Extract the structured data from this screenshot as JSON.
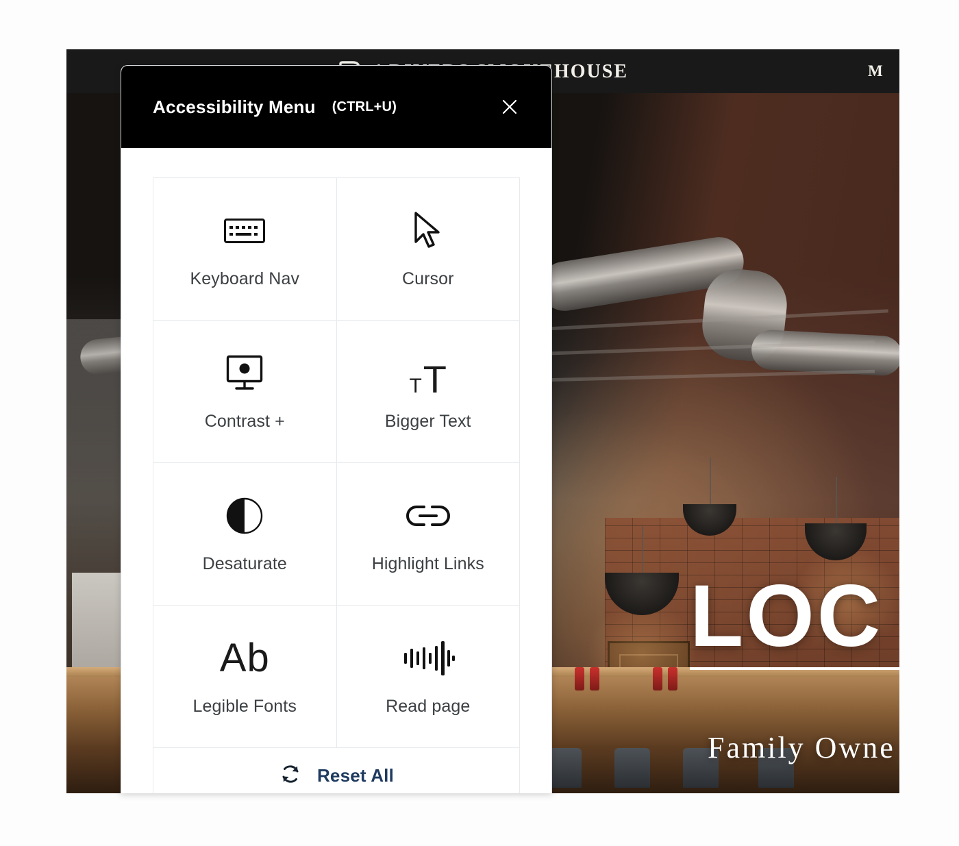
{
  "site": {
    "brand_name": "4 RIVERS SMOKEHOUSE",
    "brand_logo_icon": "r-monogram-logo-icon",
    "nav_right_label": "M",
    "hero_title": "LOC",
    "hero_subtitle": "Family Owne",
    "hero_image_alt": "restaurant-interior-photo"
  },
  "modal": {
    "title": "Accessibility Menu",
    "shortcut": "(CTRL+U)",
    "close_icon": "close-icon",
    "items": [
      {
        "label": "Keyboard Nav",
        "icon": "keyboard-icon"
      },
      {
        "label": "Cursor",
        "icon": "cursor-arrow-icon"
      },
      {
        "label": "Contrast +",
        "icon": "monitor-contrast-icon"
      },
      {
        "label": "Bigger Text",
        "icon": "bigger-text-icon"
      },
      {
        "label": "Desaturate",
        "icon": "half-filled-circle-icon"
      },
      {
        "label": "Highlight Links",
        "icon": "link-chain-icon"
      },
      {
        "label": "Legible Fonts",
        "icon": "ab-letters-icon"
      },
      {
        "label": "Read page",
        "icon": "audio-waveform-icon"
      }
    ],
    "reset": {
      "label": "Reset All",
      "icon": "refresh-cycle-icon"
    },
    "glyphs": {
      "ab": "Ab",
      "tt_small": "T",
      "tt_big": "T"
    }
  },
  "colors": {
    "modal_header_bg": "#000000",
    "modal_body_bg": "#ffffff",
    "grid_border": "#e7eaee",
    "label_text": "#3c4043",
    "reset_text": "#1e3a5f",
    "site_nav_bg": "#191919",
    "hero_text": "#ffffff"
  }
}
